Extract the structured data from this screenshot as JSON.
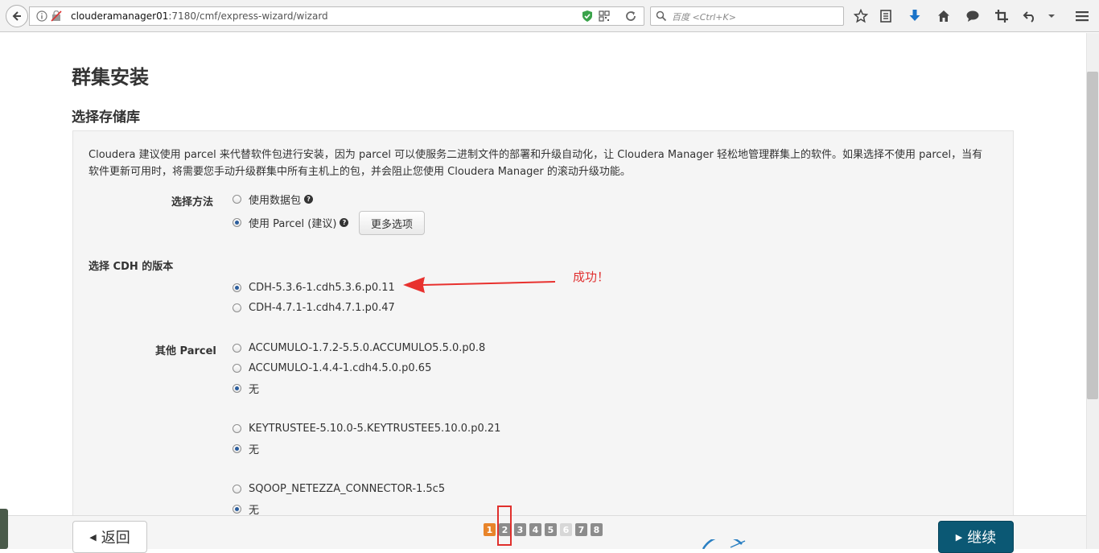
{
  "browser": {
    "url_host": "clouderamanager01",
    "url_rest": ":7180/cmf/express-wizard/wizard",
    "search_placeholder": "百度 <Ctrl+K>"
  },
  "page": {
    "title": "群集安装",
    "section_title": "选择存储库",
    "intro": "Cloudera 建议使用 parcel 来代替软件包进行安装，因为 parcel 可以使服务二进制文件的部署和升级自动化，让 Cloudera Manager 轻松地管理群集上的软件。如果选择不使用 parcel，当有软件更新可用时，将需要您手动升级群集中所有主机上的包，并会阻止您使用 Cloudera Manager 的滚动升级功能。",
    "method_label": "选择方法",
    "method_options": [
      {
        "label": "使用数据包",
        "checked": false
      },
      {
        "label": "使用 Parcel (建议)",
        "checked": true
      }
    ],
    "more_options_label": "更多选项",
    "cdh_label": "选择 CDH 的版本",
    "cdh_options": [
      {
        "label": "CDH-5.3.6-1.cdh5.3.6.p0.11",
        "checked": true
      },
      {
        "label": "CDH-4.7.1-1.cdh4.7.1.p0.47",
        "checked": false
      }
    ],
    "success_note": "成功！",
    "other_label": "其他 Parcel",
    "other_options": [
      {
        "label": "ACCUMULO-1.7.2-5.5.0.ACCUMULO5.5.0.p0.8",
        "checked": false
      },
      {
        "label": "ACCUMULO-1.4.4-1.cdh4.5.0.p0.65",
        "checked": false
      },
      {
        "label": "无",
        "checked": true
      },
      {
        "label": "KEYTRUSTEE-5.10.0-5.KEYTRUSTEE5.10.0.p0.21",
        "checked": false
      },
      {
        "label": "无",
        "checked": true
      },
      {
        "label": "SQOOP_NETEZZA_CONNECTOR-1.5c5",
        "checked": false
      },
      {
        "label": "无",
        "checked": true
      }
    ]
  },
  "footer": {
    "back_label": "返回",
    "continue_label": "继续",
    "steps": [
      "1",
      "2",
      "3",
      "4",
      "5",
      "6",
      "7",
      "8"
    ],
    "active_step": "1",
    "disabled_step": "6"
  },
  "colors": {
    "continue_button": "#0b5874",
    "active_step": "#e8842a",
    "annotation_red": "#e0302c"
  }
}
